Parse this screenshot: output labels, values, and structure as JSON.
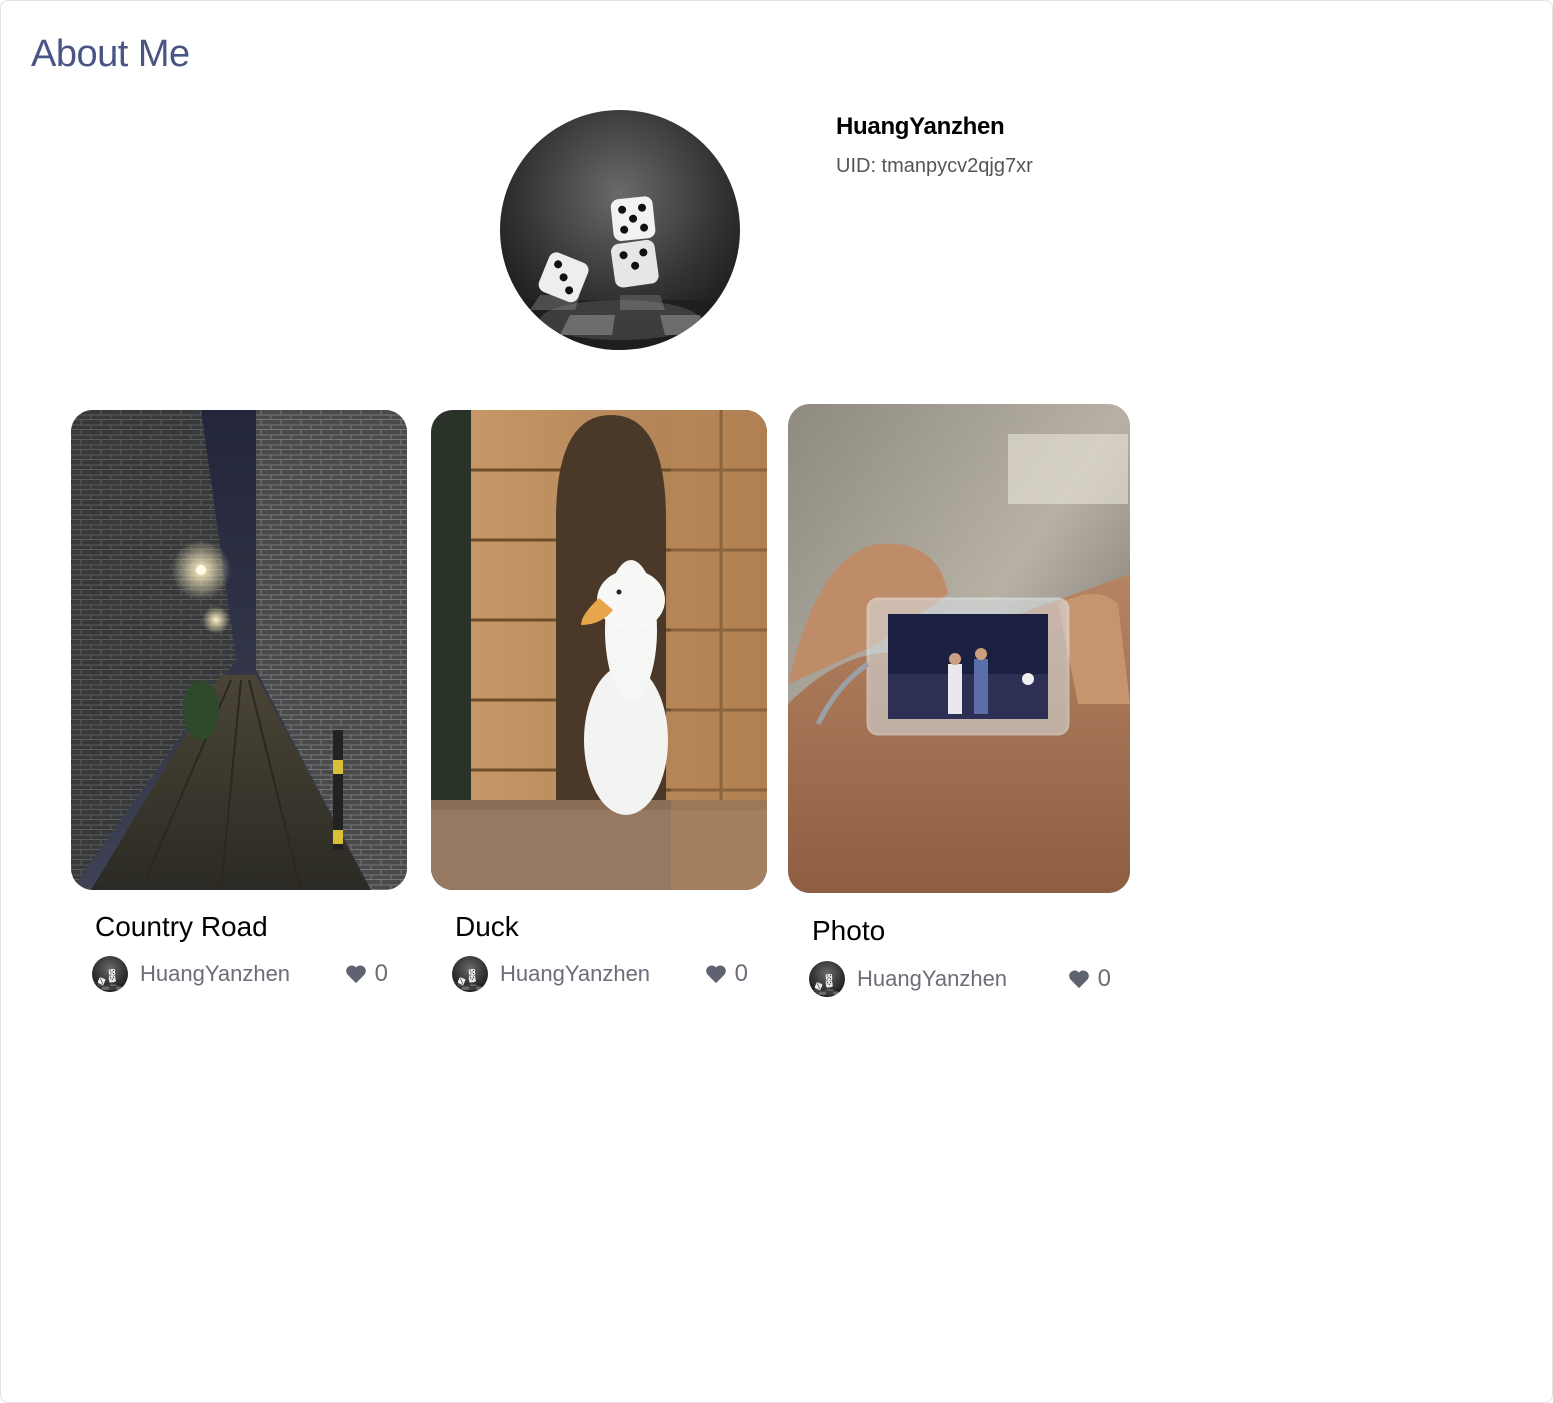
{
  "page": {
    "title": "About Me"
  },
  "profile": {
    "name": "HuangYanzhen",
    "uid": "UID: tmanpycv2qjg7xr",
    "avatar_icon": "dice-avatar-image"
  },
  "posts": [
    {
      "title": "Country Road",
      "author": "HuangYanzhen",
      "likes": "0",
      "image": "alley-photo"
    },
    {
      "title": "Duck",
      "author": "HuangYanzhen",
      "likes": "0",
      "image": "duck-photo"
    },
    {
      "title": "Photo",
      "author": "HuangYanzhen",
      "likes": "0",
      "image": "keychain-photo"
    }
  ],
  "colors": {
    "title": "#4a5585",
    "muted": "#6b6e78"
  }
}
